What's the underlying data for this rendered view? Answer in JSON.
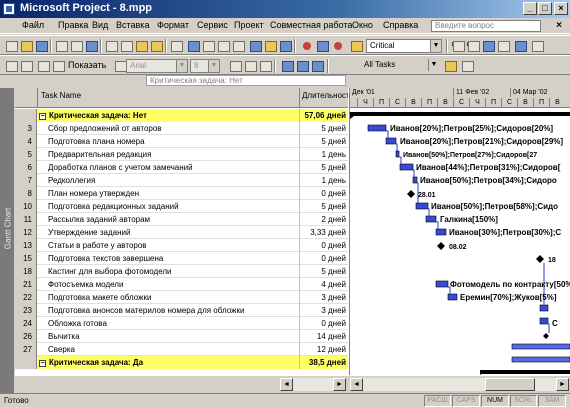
{
  "window": {
    "title": "Microsoft Project - 8.mpp"
  },
  "menu": {
    "items": [
      "Файл",
      "Правка",
      "Вид",
      "Вставка",
      "Формат",
      "Сервис",
      "Проект",
      "Совместная работа",
      "Окно",
      "Справка"
    ],
    "question_placeholder": "Введите вопрос"
  },
  "toolbar": {
    "filter_combo": "Critical",
    "show_label": "Показать",
    "font_combo": "Arial",
    "size_combo": "8",
    "all_tasks_combo": "All Tasks"
  },
  "entry_bar": {
    "value": "Критическая задача: Нет"
  },
  "view_bar": {
    "label": "Gantt Chart"
  },
  "table": {
    "headers": {
      "name": "Task Name",
      "duration": "Длительность"
    },
    "rows": [
      {
        "id": "",
        "name": "Критическая задача: Нет",
        "duration": "57,06 дней",
        "group": true
      },
      {
        "id": "3",
        "name": "Сбор предложений от авторов",
        "duration": "5 дней"
      },
      {
        "id": "4",
        "name": "Подготовка плана номера",
        "duration": "5 дней"
      },
      {
        "id": "5",
        "name": "Предварительная редакция",
        "duration": "1 день"
      },
      {
        "id": "6",
        "name": "Доработка планов с учетом замечаний",
        "duration": "5 дней"
      },
      {
        "id": "7",
        "name": "Редколлегия",
        "duration": "1 день"
      },
      {
        "id": "8",
        "name": "План номера утвержден",
        "duration": "0 дней"
      },
      {
        "id": "10",
        "name": "Подготовка редакционных заданий",
        "duration": "5 дней"
      },
      {
        "id": "11",
        "name": "Рассылка заданий авторам",
        "duration": "2 дней"
      },
      {
        "id": "12",
        "name": "Утверждение заданий",
        "duration": "3,33 дней"
      },
      {
        "id": "13",
        "name": "Статьи в работе у авторов",
        "duration": "0 дней"
      },
      {
        "id": "15",
        "name": "Подготовка текстов завершена",
        "duration": "0 дней"
      },
      {
        "id": "18",
        "name": "Кастинг для выбора фотомодели",
        "duration": "5 дней"
      },
      {
        "id": "21",
        "name": "Фотосъемка модели",
        "duration": "4 дней"
      },
      {
        "id": "22",
        "name": "Подготовка макете обложки",
        "duration": "3 дней"
      },
      {
        "id": "23",
        "name": "Подготовка анонсов материлов номера для обложки",
        "duration": "3 дней"
      },
      {
        "id": "24",
        "name": "Обложка готова",
        "duration": "0 дней"
      },
      {
        "id": "26",
        "name": "Вычитка",
        "duration": "14 дней"
      },
      {
        "id": "27",
        "name": "Сверка",
        "duration": "12 дней"
      },
      {
        "id": "",
        "name": "Критическая задача: Да",
        "duration": "38,5 дней",
        "group": true
      }
    ]
  },
  "timescale": {
    "weeks": [
      "Дек '01",
      "11 Фев '02",
      "04 Мар '02"
    ],
    "days": [
      "Ч",
      "П",
      "С",
      "В",
      "П",
      "В",
      "С",
      "Ч",
      "П",
      "С",
      "В",
      "П",
      "В"
    ]
  },
  "gantt_labels": {
    "r3": "Иванов[20%];Петров[25%];Сидоров[20%]",
    "r4": "Иванов[20%];Петров[21%];Сидоров[29%]",
    "r5": "Иванов[50%];Петров[27%];Сидоров[27",
    "r6": "Иванов[44%];Петров[31%];Сидоров[",
    "r7": "Иванов[50%];Петров[34%];Сидоро",
    "r8": "28.01",
    "r10": "Иванов[50%];Петров[58%];Сидо",
    "r11": "Галкина[150%]",
    "r12": "Иванов[30%];Петров[30%];С",
    "r13": "08.02",
    "r15": "18",
    "r21": "Фотомодель по контракту[50%]",
    "r22": "Еремин[70%];Жуков[5%]",
    "r24": "С"
  },
  "status": {
    "ready": "Готово",
    "indicators": [
      "РАСШ",
      "CAPS",
      "NUM",
      "SCRL",
      "ЗАМ"
    ],
    "active": "NUM"
  },
  "colors": {
    "group_highlight": "#ffff66",
    "bar_blue": "#3a4ad8",
    "title_blue": "#0a246a"
  }
}
